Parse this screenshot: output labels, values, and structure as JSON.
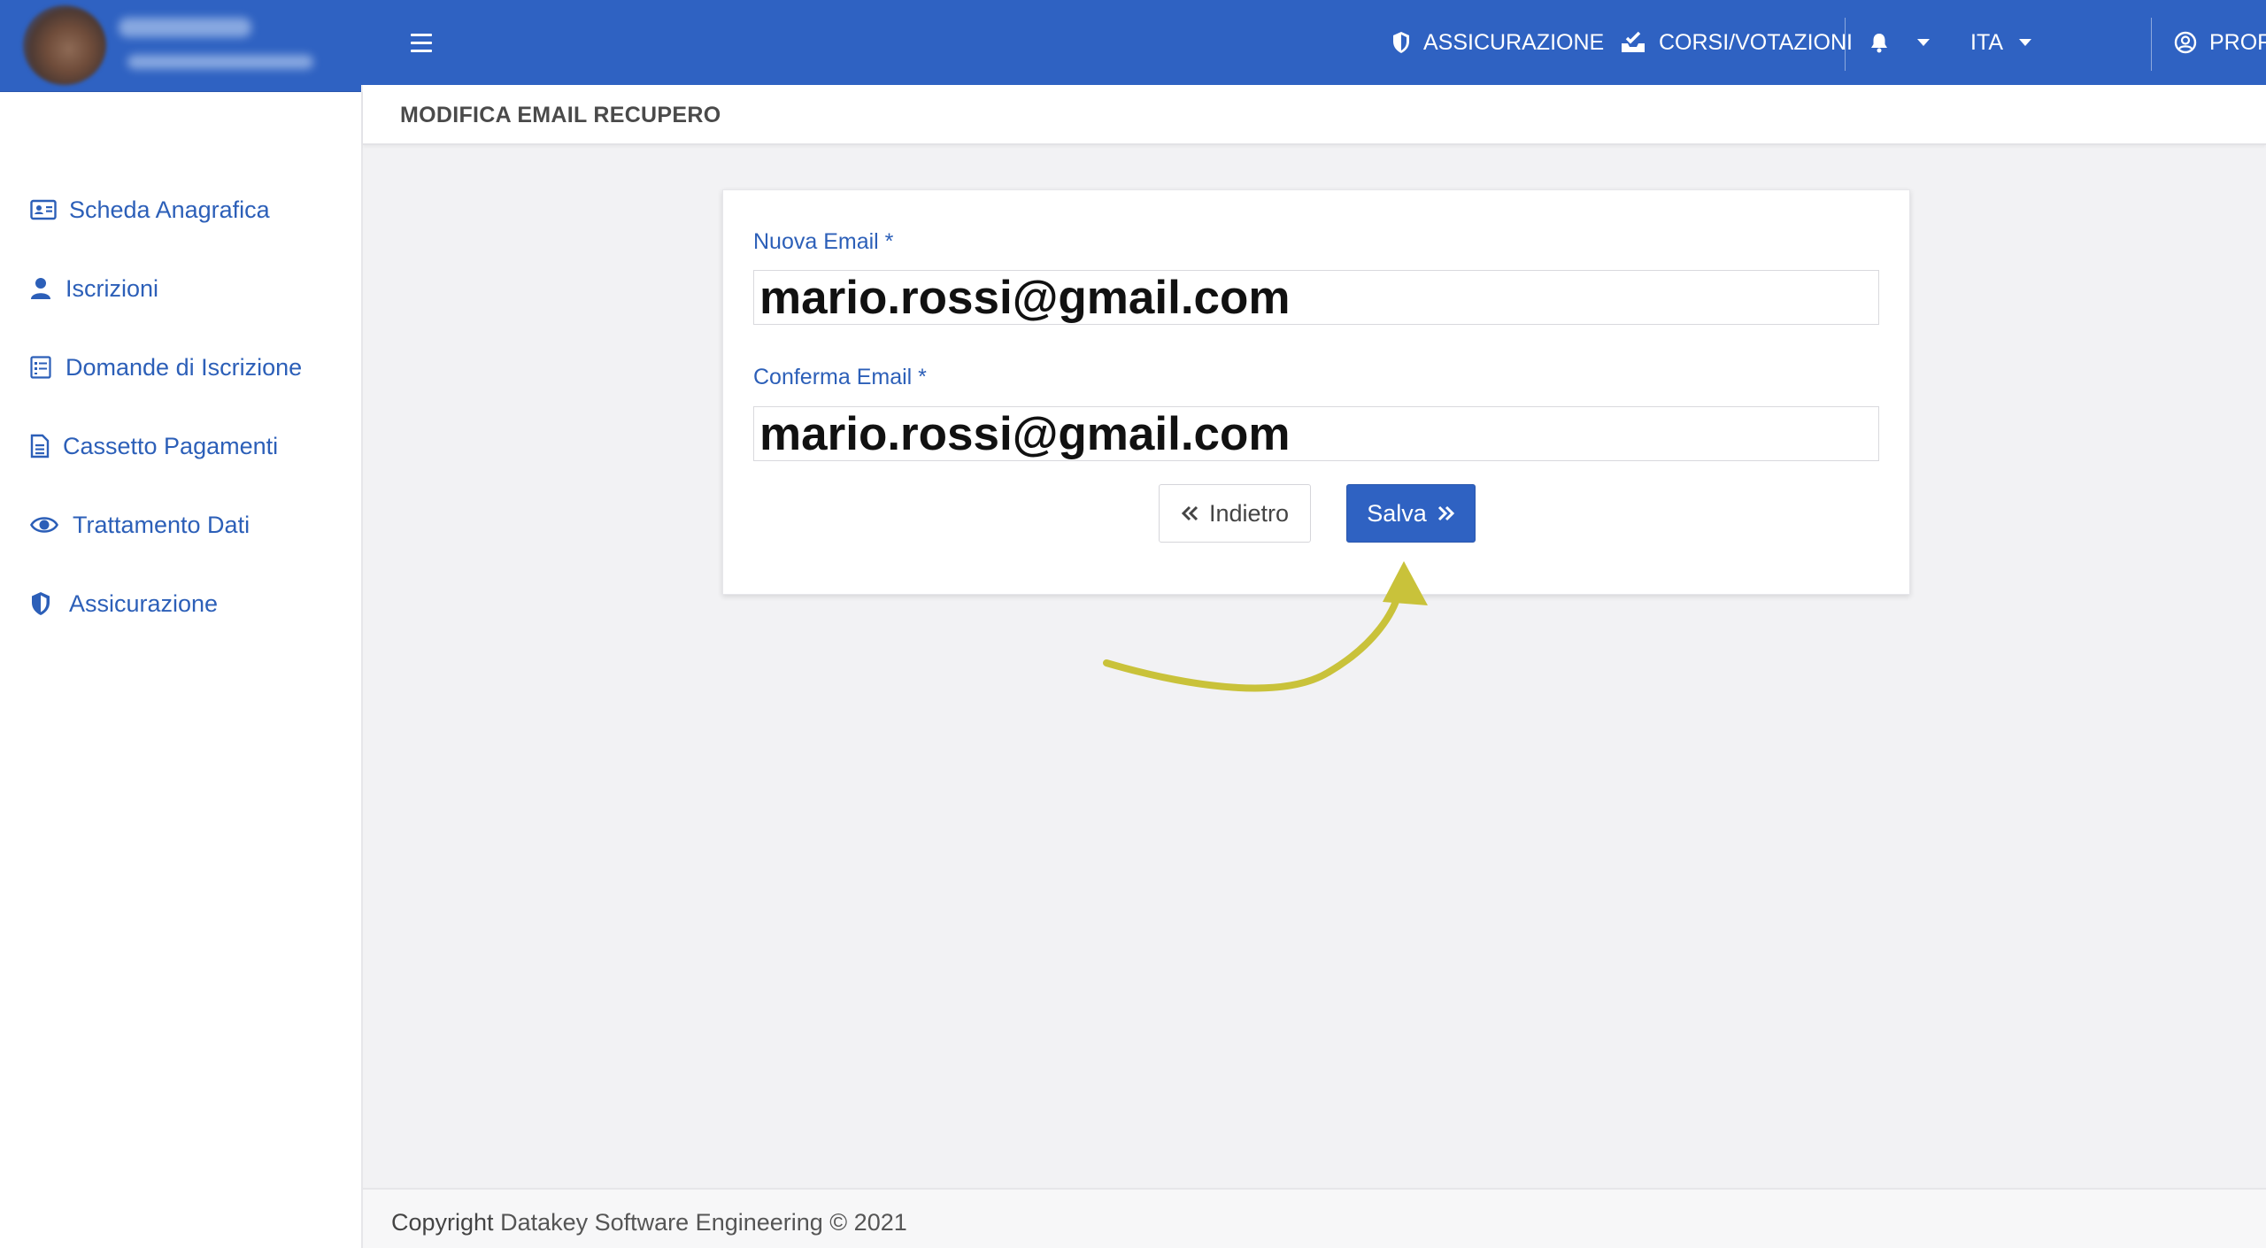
{
  "app": {
    "colors": {
      "primary": "#2f62c2",
      "link": "#2c5fb8",
      "annotation_arrow": "#c9c23a"
    }
  },
  "header": {
    "nav": {
      "insurance_label": "ASSICURAZIONE",
      "courses_label": "CORSI/VOTAZIONI",
      "language_label": "ITA",
      "profile_label": "PROFILO"
    },
    "icons": [
      "menu-icon",
      "shield-icon",
      "inbox-check-icon",
      "bell-icon",
      "user-circle-icon"
    ]
  },
  "sidebar": {
    "items": [
      {
        "label": "Scheda Anagrafica",
        "icon": "id-card-icon"
      },
      {
        "label": "Iscrizioni",
        "icon": "user-icon"
      },
      {
        "label": "Domande di Iscrizione",
        "icon": "form-icon"
      },
      {
        "label": "Cassetto Pagamenti",
        "icon": "document-icon"
      },
      {
        "label": "Trattamento Dati",
        "icon": "eye-icon"
      },
      {
        "label": "Assicurazione",
        "icon": "shield-icon"
      }
    ]
  },
  "page": {
    "title": "MODIFICA EMAIL RECUPERO"
  },
  "form": {
    "new_email": {
      "label": "Nuova Email *",
      "value": "mario.rossi@gmail.com"
    },
    "confirm_email": {
      "label": "Conferma Email *",
      "value": "mario.rossi@gmail.com"
    },
    "back_label": "Indietro",
    "save_label": "Salva"
  },
  "footer": {
    "copyright_label": "Copyright",
    "company": "Datakey Software Engineering © 2021"
  }
}
